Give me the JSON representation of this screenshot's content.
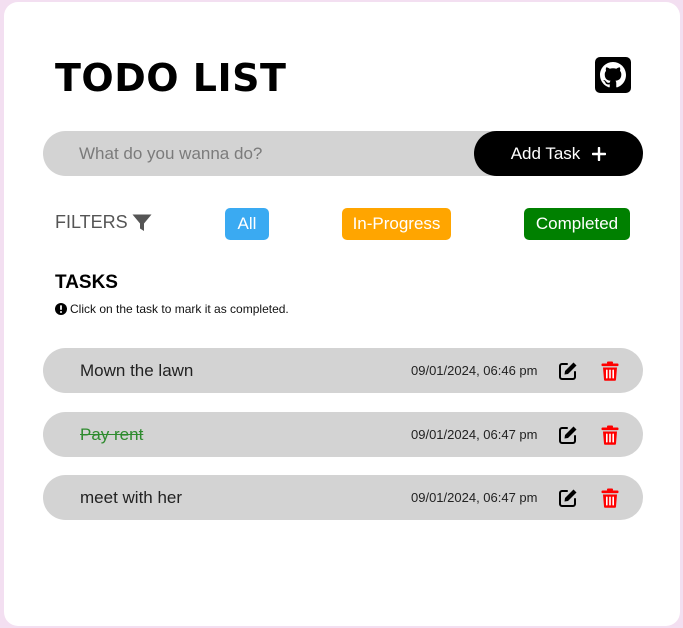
{
  "app": {
    "title": "TODO LIST"
  },
  "header": {
    "github_icon": "github-icon"
  },
  "form": {
    "placeholder": "What do you wanna do?",
    "value": "",
    "add_label": "Add Task",
    "add_icon": "plus-icon"
  },
  "filters": {
    "label": "FILTERS",
    "icon": "filter-icon",
    "options": [
      {
        "label": "All",
        "color": "#3aaaf2"
      },
      {
        "label": "In-Progress",
        "color": "#ffa500"
      },
      {
        "label": "Completed",
        "color": "#008000"
      }
    ]
  },
  "tasks_section": {
    "heading": "TASKS",
    "hint": "Click on the task to mark it as completed.",
    "hint_icon": "exclamation-circle-icon"
  },
  "tasks": [
    {
      "text": "Mown the lawn",
      "date": "09/01/2024, 06:46 pm",
      "completed": false
    },
    {
      "text": "Pay rent",
      "date": "09/01/2024, 06:47 pm",
      "completed": true
    },
    {
      "text": "meet with her",
      "date": "09/01/2024, 06:47 pm",
      "completed": false
    }
  ],
  "colors": {
    "page_bg": "#f3dff1",
    "card_bg": "#ffffff",
    "row_bg": "#d3d3d3",
    "completed_text": "#2e8b2e",
    "delete_icon": "#ff0000",
    "primary": "#000000"
  }
}
